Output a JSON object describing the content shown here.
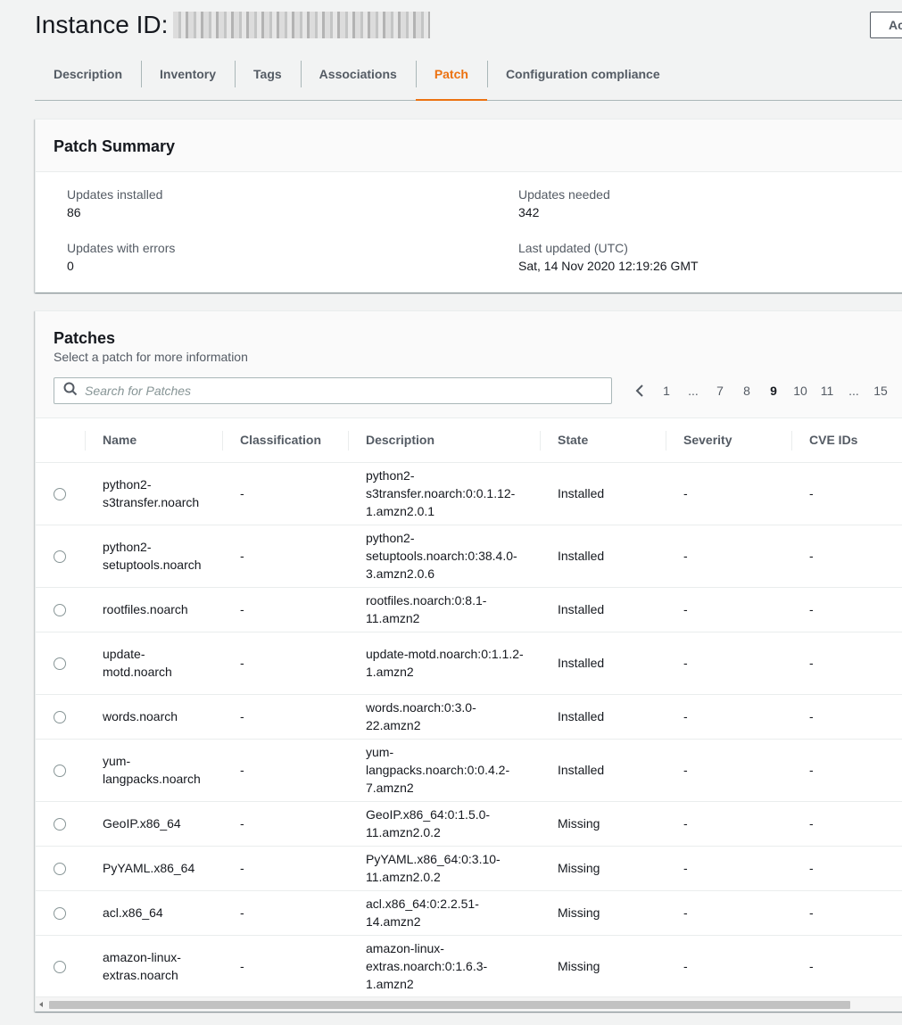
{
  "header": {
    "title": "Instance ID:",
    "action_button_label": "Ac"
  },
  "tabs": [
    {
      "label": "Description",
      "active": false
    },
    {
      "label": "Inventory",
      "active": false
    },
    {
      "label": "Tags",
      "active": false
    },
    {
      "label": "Associations",
      "active": false
    },
    {
      "label": "Patch",
      "active": true
    },
    {
      "label": "Configuration compliance",
      "active": false
    }
  ],
  "accent_color": "#ec7211",
  "summary": {
    "title": "Patch Summary",
    "updates_installed_label": "Updates installed",
    "updates_installed": "86",
    "updates_needed_label": "Updates needed",
    "updates_needed": "342",
    "updates_errors_label": "Updates with errors",
    "updates_errors": "0",
    "last_updated_label": "Last updated (UTC)",
    "last_updated": "Sat, 14 Nov 2020 12:19:26 GMT"
  },
  "patches": {
    "title": "Patches",
    "subtitle": "Select a patch for more information",
    "search_placeholder": "Search for Patches",
    "pagination": [
      "1",
      "...",
      "7",
      "8",
      "9",
      "10",
      "11",
      "...",
      "15"
    ],
    "current_page": "9",
    "columns": [
      "Name",
      "Classification",
      "Description",
      "State",
      "Severity",
      "CVE IDs"
    ],
    "rows": [
      {
        "name": "python2-s3transfer.noarch",
        "classification": "-",
        "description": "python2-s3transfer.noarch:0:0.1.12-1.amzn2.0.1",
        "state": "Installed",
        "severity": "-",
        "cve": "-"
      },
      {
        "name": "python2-setuptools.noarch",
        "classification": "-",
        "description": "python2-setuptools.noarch:0:38.4.0-3.amzn2.0.6",
        "state": "Installed",
        "severity": "-",
        "cve": "-"
      },
      {
        "name": "rootfiles.noarch",
        "classification": "-",
        "description": "rootfiles.noarch:0:8.1-11.amzn2",
        "state": "Installed",
        "severity": "-",
        "cve": "-"
      },
      {
        "name": "update-motd.noarch",
        "classification": "-",
        "description": "update-motd.noarch:0:1.1.2-1.amzn2",
        "state": "Installed",
        "severity": "-",
        "cve": "-"
      },
      {
        "name": "words.noarch",
        "classification": "-",
        "description": "words.noarch:0:3.0-22.amzn2",
        "state": "Installed",
        "severity": "-",
        "cve": "-"
      },
      {
        "name": "yum-langpacks.noarch",
        "classification": "-",
        "description": "yum-langpacks.noarch:0:0.4.2-7.amzn2",
        "state": "Installed",
        "severity": "-",
        "cve": "-"
      },
      {
        "name": "GeoIP.x86_64",
        "classification": "-",
        "description": "GeoIP.x86_64:0:1.5.0-11.amzn2.0.2",
        "state": "Missing",
        "severity": "-",
        "cve": "-"
      },
      {
        "name": "PyYAML.x86_64",
        "classification": "-",
        "description": "PyYAML.x86_64:0:3.10-11.amzn2.0.2",
        "state": "Missing",
        "severity": "-",
        "cve": "-"
      },
      {
        "name": "acl.x86_64",
        "classification": "-",
        "description": "acl.x86_64:0:2.2.51-14.amzn2",
        "state": "Missing",
        "severity": "-",
        "cve": "-"
      },
      {
        "name": "amazon-linux-extras.noarch",
        "classification": "-",
        "description": "amazon-linux-extras.noarch:0:1.6.3-1.amzn2",
        "state": "Missing",
        "severity": "-",
        "cve": "-"
      }
    ]
  }
}
